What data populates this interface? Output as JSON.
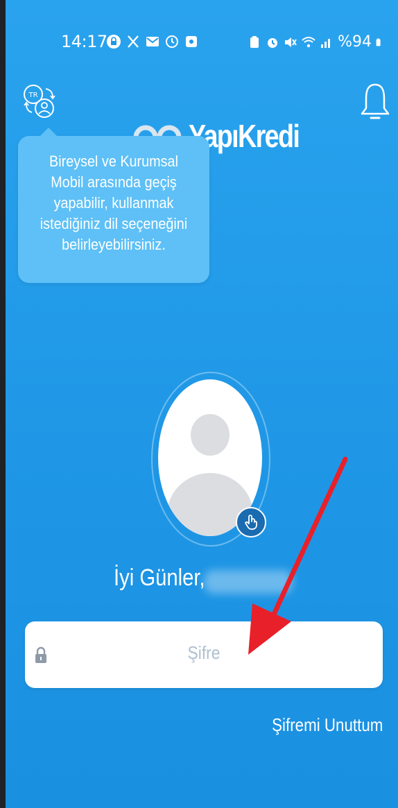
{
  "status_bar": {
    "time": "14:17",
    "battery": "%94",
    "left_icons": [
      "lock-app-icon",
      "x-app-icon",
      "mail-icon",
      "clock-icon",
      "app-icon"
    ],
    "right_icons": [
      "battery-saver-icon",
      "alarm-icon",
      "mute-icon",
      "wifi-icon",
      "signal-icon",
      "battery-icon"
    ]
  },
  "header": {
    "brand": "YapıKredi",
    "language_badge": "TR"
  },
  "tooltip": {
    "text": "Bireysel ve Kurumsal Mobil arasında geçiş yapabilir, kullanmak istediğiniz dil seçeneğini belirleyebilirsiniz."
  },
  "login": {
    "greeting": "İyi Günler,",
    "password_placeholder": "Şifre",
    "forgot_password": "Şifremi Unuttum"
  },
  "colors": {
    "background": "#1f97e6",
    "tooltip": "#5ec0f6",
    "arrow": "#e8202a"
  }
}
